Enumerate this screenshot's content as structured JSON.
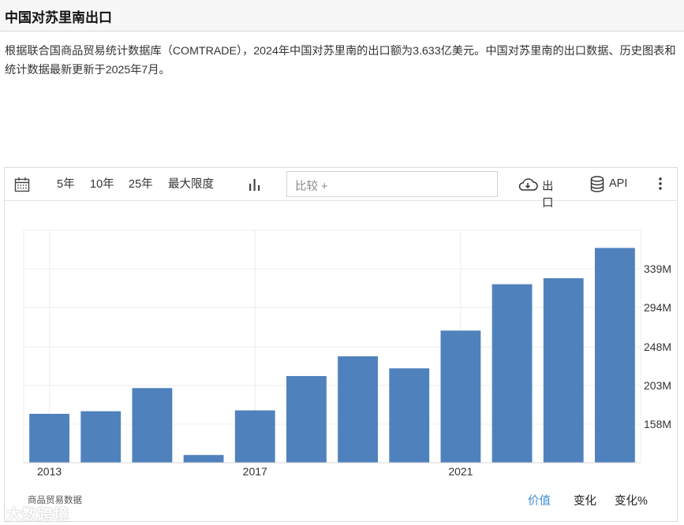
{
  "header": {
    "title": "中国对苏里南出口"
  },
  "description": "根据联合国商品贸易统计数据库（COMTRADE），2024年中国对苏里南的出口额为3.633亿美元。中国对苏里南的出口数据、历史图表和统计数据最新更新于2025年7月。",
  "toolbar": {
    "range_5y": "5年",
    "range_10y": "10年",
    "range_25y": "25年",
    "range_max": "最大限度",
    "compare_placeholder": "比较 +",
    "export_label": "出口",
    "api_label": "API"
  },
  "footer": {
    "source": "商品贸易数据",
    "tab_value": "价值",
    "tab_change": "变化",
    "tab_change_pct": "变化%"
  },
  "watermark": "大数跨境",
  "colors": {
    "bar": "#4f81bd",
    "accent": "#3c8dd1"
  },
  "chart_data": {
    "type": "bar",
    "categories": [
      "2013",
      "2014",
      "2015",
      "2016",
      "2017",
      "2018",
      "2019",
      "2020",
      "2021",
      "2022",
      "2023",
      "2024"
    ],
    "values": [
      170,
      173,
      200,
      122,
      174,
      214,
      237,
      223,
      267,
      321,
      328,
      363.3
    ],
    "x_tick_labels": [
      "2013",
      "2017",
      "2021"
    ],
    "y_tick_labels": [
      "158M",
      "203M",
      "248M",
      "294M",
      "339M"
    ],
    "y_ticks": [
      158,
      203,
      248,
      294,
      339
    ],
    "ylim": [
      113,
      384
    ],
    "y_axis_side": "right",
    "grid": true
  }
}
